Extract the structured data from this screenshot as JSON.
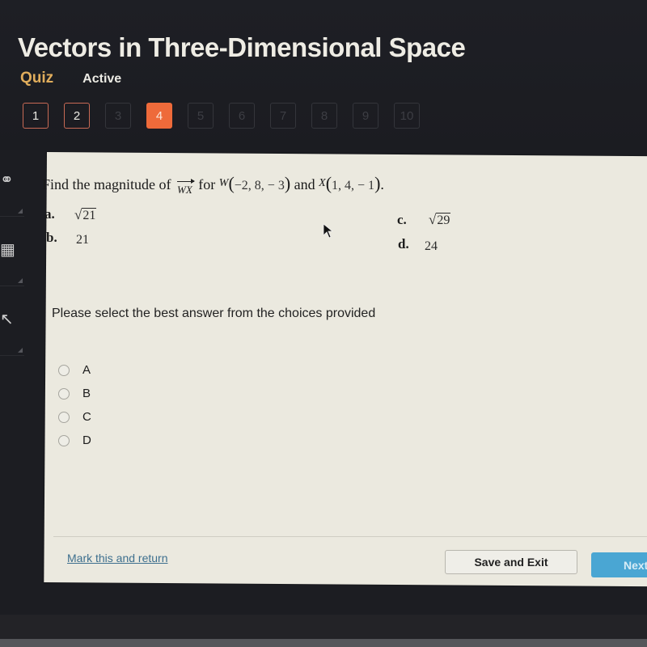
{
  "header": {
    "title": "Vectors in Three-Dimensional Space",
    "type_label": "Quiz",
    "status": "Active"
  },
  "question_nav": {
    "current": 4,
    "items": [
      {
        "label": "1",
        "state": "visited"
      },
      {
        "label": "2",
        "state": "visited"
      },
      {
        "label": "3",
        "state": "unvisited"
      },
      {
        "label": "4",
        "state": "current"
      },
      {
        "label": "5",
        "state": "unvisited"
      },
      {
        "label": "6",
        "state": "unvisited"
      },
      {
        "label": "7",
        "state": "unvisited"
      },
      {
        "label": "8",
        "state": "unvisited"
      },
      {
        "label": "9",
        "state": "unvisited"
      },
      {
        "label": "10",
        "state": "unvisited"
      }
    ]
  },
  "sidebar": {
    "tools": [
      "headphones-icon",
      "calculator-icon",
      "pointer-tool-icon"
    ]
  },
  "question": {
    "prefix": "Find the magnitude of",
    "vector": "WX",
    "for_word": "for",
    "point1_name": "W",
    "point1_coords": "−2, 8, − 3",
    "and_word": "and",
    "point2_name": "X",
    "point2_coords": "1, 4, − 1",
    "period": ".",
    "choices": [
      {
        "letter": "a.",
        "value": "21",
        "sqrt": true
      },
      {
        "letter": "b.",
        "value": "21",
        "sqrt": false
      },
      {
        "letter": "c.",
        "value": "29",
        "sqrt": true
      },
      {
        "letter": "d.",
        "value": "24",
        "sqrt": false
      }
    ]
  },
  "instruction": "Please select the best answer from the choices provided",
  "answer_options": [
    {
      "label": "A",
      "selected": false
    },
    {
      "label": "B",
      "selected": false
    },
    {
      "label": "C",
      "selected": false
    },
    {
      "label": "D",
      "selected": false
    }
  ],
  "footer": {
    "mark_link": "Mark this and return",
    "save_button": "Save and Exit",
    "next_button": "Next"
  },
  "colors": {
    "accent_orange": "#ee6a3a",
    "quiz_label": "#e0ad5c",
    "next_blue": "#4aa6d3",
    "link_blue": "#3d6f8e"
  }
}
